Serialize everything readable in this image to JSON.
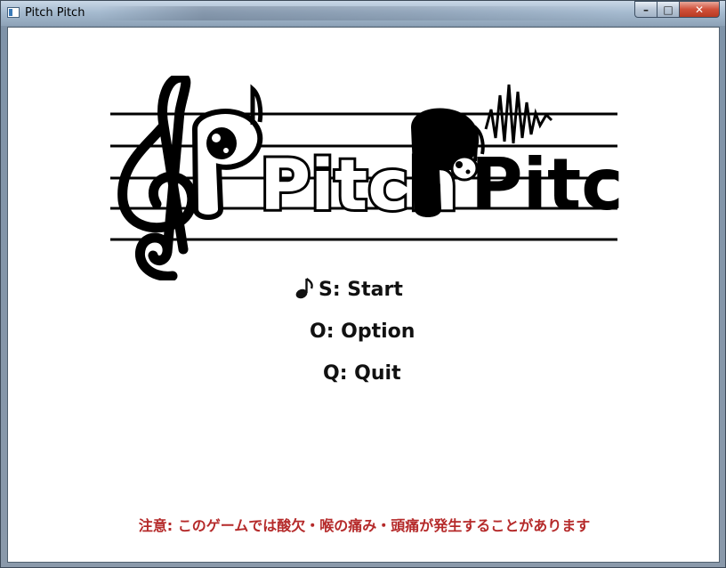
{
  "window": {
    "title": "Pitch Pitch",
    "controls": {
      "minimize": "–",
      "maximize": "□",
      "close": "✕"
    }
  },
  "logo": {
    "text_left": "Pitch",
    "text_right": "Pitch"
  },
  "menu": {
    "cursor_icon": "music-note-icon",
    "items": [
      {
        "label": "S: Start",
        "selected": true
      },
      {
        "label": "O: Option",
        "selected": false
      },
      {
        "label": "Q: Quit",
        "selected": false
      }
    ]
  },
  "notice": "注意: このゲームでは酸欠・喉の痛み・頭痛が発生することがあります",
  "colors": {
    "notice": "#b52a2a",
    "menu_text": "#111111"
  }
}
